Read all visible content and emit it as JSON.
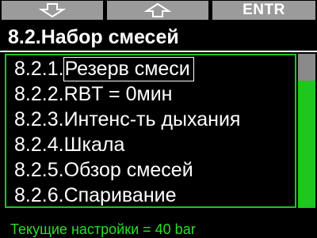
{
  "softkeys": {
    "left_icon": "arrow-down-icon",
    "middle_icon": "arrow-up-icon",
    "right_label": "ENTR"
  },
  "header": {
    "title": "8.2.Набор смесей"
  },
  "menu": {
    "items": [
      {
        "number": "8.2.1.",
        "label": "Резерв смеси",
        "selected": true
      },
      {
        "number": "8.2.2.",
        "label": "RBT = 0мин",
        "selected": false
      },
      {
        "number": "8.2.3.",
        "label": "Интенс-ть дыхания",
        "selected": false
      },
      {
        "number": "8.2.4.",
        "label": "Шкала",
        "selected": false
      },
      {
        "number": "8.2.5.",
        "label": "Обзор смесей",
        "selected": false
      },
      {
        "number": "8.2.6.",
        "label": "Спаривание",
        "selected": false
      }
    ],
    "scroll_position": 0
  },
  "status": {
    "text": "Текущие настройки = 40 bar"
  },
  "colors": {
    "accent": "#1ec61e",
    "status_text": "#2bdc2b",
    "softkey_bg": "#9b9b9b",
    "background": "#000000"
  }
}
